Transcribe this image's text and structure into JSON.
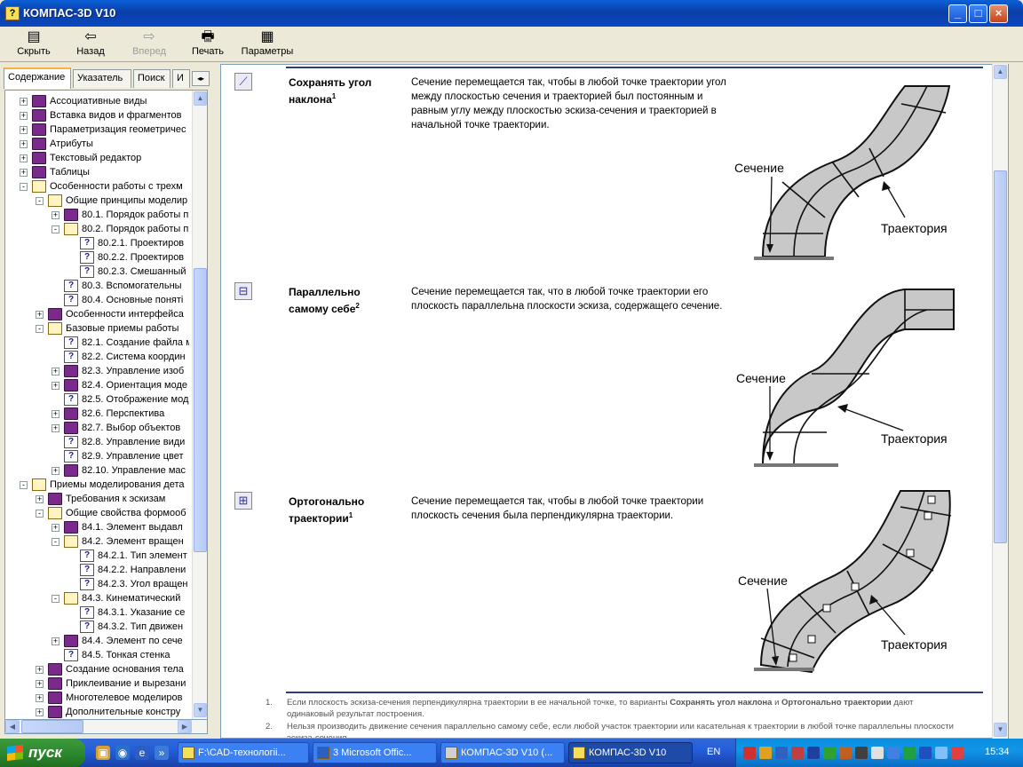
{
  "window": {
    "title": "КОМПАС-3D V10"
  },
  "toolbar": {
    "hide": "Скрыть",
    "back": "Назад",
    "forward": "Вперед",
    "print": "Печать",
    "options": "Параметры"
  },
  "tabs": [
    "Содержание",
    "Указатель",
    "Поиск",
    "И"
  ],
  "tree": [
    {
      "indent": 0,
      "exp": "+",
      "icon": "book",
      "label": "Ассоциативные виды"
    },
    {
      "indent": 0,
      "exp": "+",
      "icon": "book",
      "label": "Вставка видов и фрагментов"
    },
    {
      "indent": 0,
      "exp": "+",
      "icon": "book",
      "label": "Параметризация геометричес"
    },
    {
      "indent": 0,
      "exp": "+",
      "icon": "book",
      "label": "Атрибуты"
    },
    {
      "indent": 0,
      "exp": "+",
      "icon": "book",
      "label": "Текстовый редактор"
    },
    {
      "indent": 0,
      "exp": "+",
      "icon": "book",
      "label": "Таблицы"
    },
    {
      "indent": 0,
      "exp": "-",
      "icon": "open",
      "label": "Особенности работы с трехм"
    },
    {
      "indent": 1,
      "exp": "-",
      "icon": "open",
      "label": "Общие принципы моделир"
    },
    {
      "indent": 2,
      "exp": "+",
      "icon": "book",
      "label": "80.1. Порядок работы п"
    },
    {
      "indent": 2,
      "exp": "-",
      "icon": "open",
      "label": "80.2. Порядок работы п"
    },
    {
      "indent": 3,
      "exp": "",
      "icon": "help",
      "label": "80.2.1. Проектиров"
    },
    {
      "indent": 3,
      "exp": "",
      "icon": "help",
      "label": "80.2.2. Проектиров"
    },
    {
      "indent": 3,
      "exp": "",
      "icon": "help",
      "label": "80.2.3. Смешанный"
    },
    {
      "indent": 2,
      "exp": "",
      "icon": "help",
      "label": "80.3. Вспомогательны"
    },
    {
      "indent": 2,
      "exp": "",
      "icon": "help",
      "label": "80.4. Основные поняті"
    },
    {
      "indent": 1,
      "exp": "+",
      "icon": "book",
      "label": "Особенности интерфейса"
    },
    {
      "indent": 1,
      "exp": "-",
      "icon": "open",
      "label": "Базовые приемы работы"
    },
    {
      "indent": 2,
      "exp": "",
      "icon": "help",
      "label": "82.1. Создание файла м"
    },
    {
      "indent": 2,
      "exp": "",
      "icon": "help",
      "label": "82.2. Система координ"
    },
    {
      "indent": 2,
      "exp": "+",
      "icon": "book",
      "label": "82.3. Управление изоб"
    },
    {
      "indent": 2,
      "exp": "+",
      "icon": "book",
      "label": "82.4. Ориентация моде"
    },
    {
      "indent": 2,
      "exp": "",
      "icon": "help",
      "label": "82.5. Отображение мод"
    },
    {
      "indent": 2,
      "exp": "+",
      "icon": "book",
      "label": "82.6. Перспектива"
    },
    {
      "indent": 2,
      "exp": "+",
      "icon": "book",
      "label": "82.7. Выбор объектов"
    },
    {
      "indent": 2,
      "exp": "",
      "icon": "help",
      "label": "82.8. Управление види"
    },
    {
      "indent": 2,
      "exp": "",
      "icon": "help",
      "label": "82.9. Управление цвет"
    },
    {
      "indent": 2,
      "exp": "+",
      "icon": "book",
      "label": "82.10. Управление мас"
    },
    {
      "indent": 0,
      "exp": "-",
      "icon": "open",
      "label": "Приемы моделирования дета"
    },
    {
      "indent": 1,
      "exp": "+",
      "icon": "book",
      "label": "Требования к эскизам"
    },
    {
      "indent": 1,
      "exp": "-",
      "icon": "open",
      "label": "Общие свойства формооб"
    },
    {
      "indent": 2,
      "exp": "+",
      "icon": "book",
      "label": "84.1. Элемент выдавл"
    },
    {
      "indent": 2,
      "exp": "-",
      "icon": "open",
      "label": "84.2. Элемент вращен"
    },
    {
      "indent": 3,
      "exp": "",
      "icon": "help",
      "label": "84.2.1. Тип элемент"
    },
    {
      "indent": 3,
      "exp": "",
      "icon": "help",
      "label": "84.2.2. Направлени"
    },
    {
      "indent": 3,
      "exp": "",
      "icon": "help",
      "label": "84.2.3. Угол вращен"
    },
    {
      "indent": 2,
      "exp": "-",
      "icon": "open",
      "label": "84.3. Кинематический"
    },
    {
      "indent": 3,
      "exp": "",
      "icon": "help",
      "label": "84.3.1. Указание се"
    },
    {
      "indent": 3,
      "exp": "",
      "icon": "help",
      "label": "84.3.2. Тип движен"
    },
    {
      "indent": 2,
      "exp": "+",
      "icon": "book",
      "label": "84.4. Элемент по сече"
    },
    {
      "indent": 2,
      "exp": "",
      "icon": "help",
      "label": "84.5. Тонкая стенка"
    },
    {
      "indent": 1,
      "exp": "+",
      "icon": "book",
      "label": "Создание основания тела"
    },
    {
      "indent": 1,
      "exp": "+",
      "icon": "book",
      "label": "Приклеивание и вырезани"
    },
    {
      "indent": 1,
      "exp": "+",
      "icon": "book",
      "label": "Многотелевое моделиров"
    },
    {
      "indent": 1,
      "exp": "+",
      "icon": "book",
      "label": "Дополнительные констру"
    }
  ],
  "sections": [
    {
      "title": "Сохранять угол наклона",
      "sup": "1",
      "desc": "Сечение перемещается так, чтобы в любой точке траектории угол между плоскостью сечения и траекторией был постоянным и равным углу между плоскостью эскиза-сечения и траекторией в начальной точке траектории.",
      "label_section": "Сечение",
      "label_trajectory": "Траектория"
    },
    {
      "title": "Параллельно самому себе",
      "sup": "2",
      "desc": "Сечение перемещается так, что в любой точке траектории его плоскость параллельна плоскости эскиза, содержащего сечение.",
      "label_section": "Сечение",
      "label_trajectory": "Траектория"
    },
    {
      "title": "Ортогонально траектории",
      "sup": "1",
      "desc": "Сечение перемещается так, чтобы в любой точке траектории плоскость сечения была перпендикулярна траектории.",
      "label_section": "Сечение",
      "label_trajectory": "Траектория"
    }
  ],
  "notes": [
    {
      "num": "1.",
      "pre": "Если плоскость эскиза-сечения перпендикулярна траектории в ее начальной точке, то варианты ",
      "b1": "Сохранять угол наклона",
      "mid": " и ",
      "b2": "Ортогонально траектории",
      "post": " дают одинаковый результат построения."
    },
    {
      "num": "2.",
      "pre": "Нельзя производить движение сечения параллельно самому себе, если любой участок траектории или касательная к траектории в любой точке параллельны плоскости эскиза-сечения.",
      "b1": "",
      "mid": "",
      "b2": "",
      "post": ""
    }
  ],
  "taskbar": {
    "start": "пуск",
    "items": [
      "F:\\CAD-технологіі...",
      "3 Microsoft Offic...",
      "КОМПАС-3D V10 (...",
      "КОМПАС-3D V10"
    ],
    "lang": "EN",
    "clock": "15:34"
  }
}
